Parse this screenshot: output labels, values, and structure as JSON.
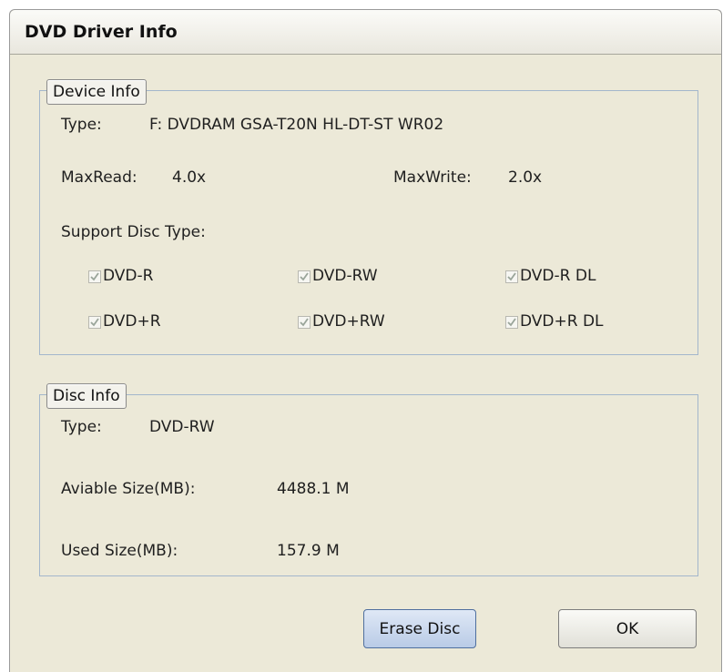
{
  "window": {
    "title": "DVD Driver Info"
  },
  "device_info": {
    "legend": "Device Info",
    "type_label": "Type:",
    "type_value": "F: DVDRAM GSA-T20N  HL-DT-ST WR02",
    "max_read_label": "MaxRead:",
    "max_read_value": "4.0x",
    "max_write_label": "MaxWrite:",
    "max_write_value": "2.0x",
    "support_label": "Support Disc Type:",
    "disc_types": [
      {
        "label": "DVD-R",
        "checked": true
      },
      {
        "label": "DVD-RW",
        "checked": true
      },
      {
        "label": "DVD-R DL",
        "checked": true
      },
      {
        "label": "DVD+R",
        "checked": true
      },
      {
        "label": "DVD+RW",
        "checked": true
      },
      {
        "label": "DVD+R DL",
        "checked": true
      }
    ]
  },
  "disc_info": {
    "legend": "Disc Info",
    "type_label": "Type:",
    "type_value": "DVD-RW",
    "available_label": "Aviable Size(MB):",
    "available_value": "4488.1 M",
    "used_label": "Used Size(MB):",
    "used_value": "157.9 M"
  },
  "buttons": {
    "erase": "Erase Disc",
    "ok": "OK"
  }
}
